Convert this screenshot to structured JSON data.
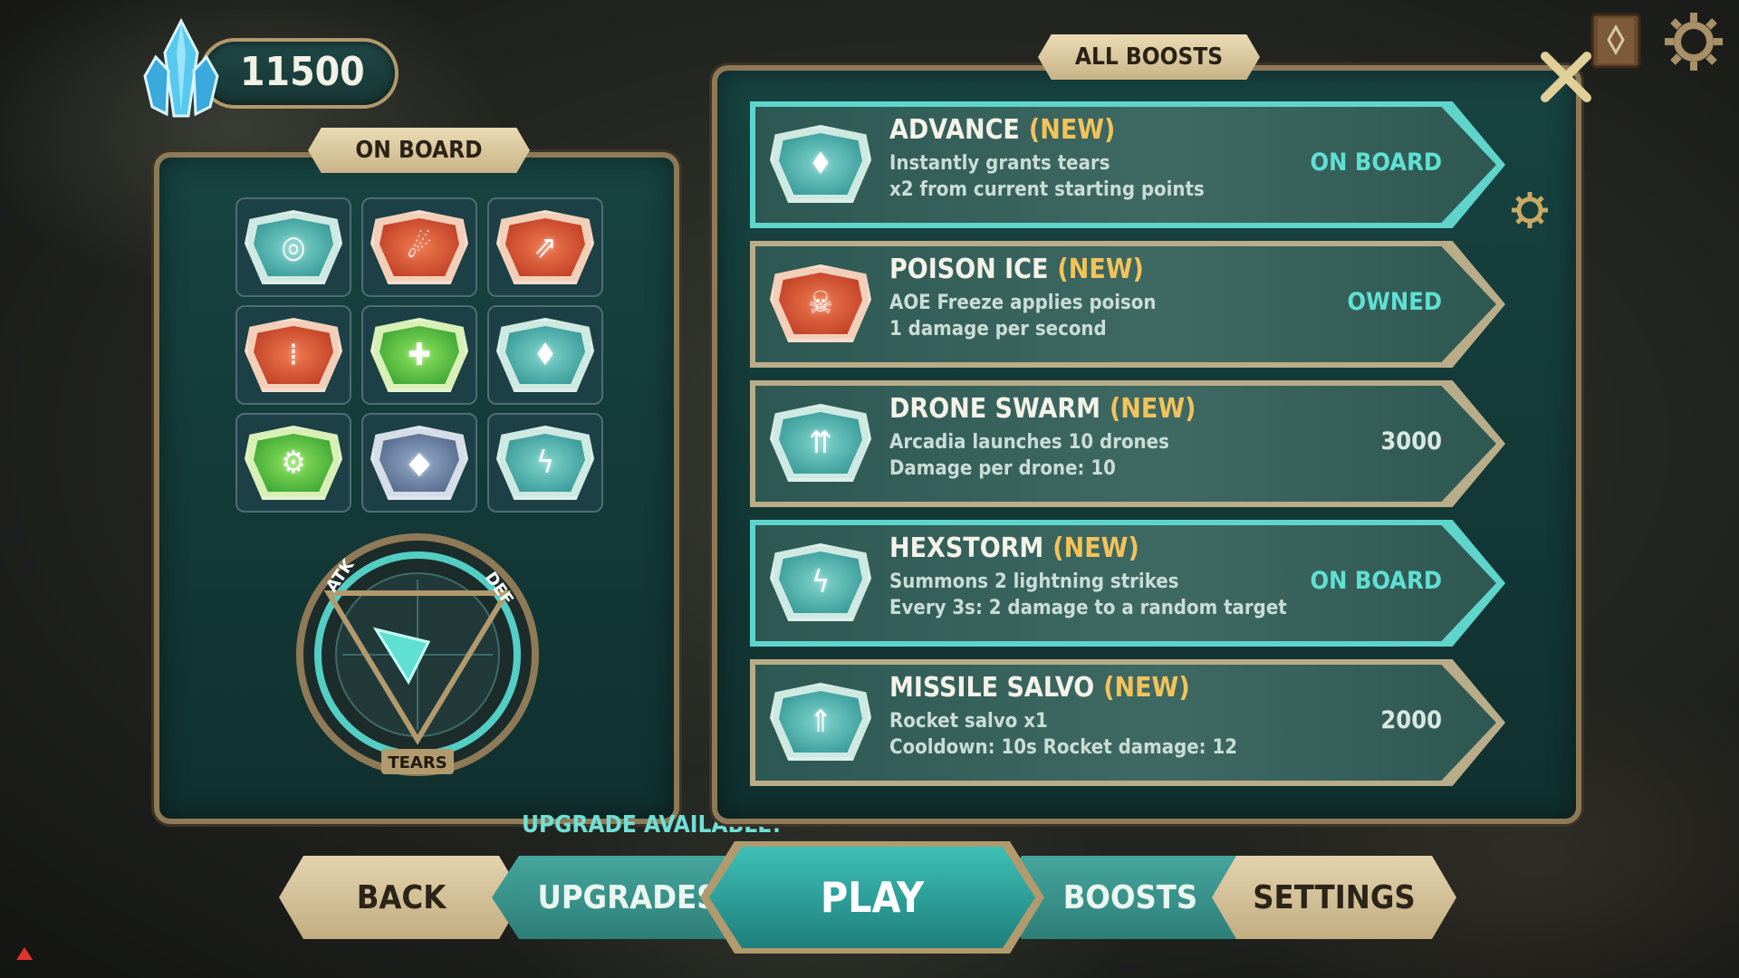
{
  "currency": {
    "amount": "11500",
    "icon": "crystal-icon"
  },
  "board": {
    "title": "ON BOARD",
    "slots": [
      {
        "icon": "burning-ring-icon",
        "color": "teal",
        "glyph": "◎"
      },
      {
        "icon": "meteor-icon",
        "color": "red",
        "glyph": "☄"
      },
      {
        "icon": "rocket-icon",
        "color": "red",
        "glyph": "⇗"
      },
      {
        "icon": "bullets-icon",
        "color": "red",
        "glyph": "⁞"
      },
      {
        "icon": "repair-cross-icon",
        "color": "green",
        "glyph": "✚"
      },
      {
        "icon": "crystal-shard-icon",
        "color": "teal",
        "glyph": "♦"
      },
      {
        "icon": "gear-wrench-icon",
        "color": "green",
        "glyph": "⚙"
      },
      {
        "icon": "crystal-cluster-icon",
        "color": "blue",
        "glyph": "◆"
      },
      {
        "icon": "lightning-icon",
        "color": "teal",
        "glyph": "ϟ"
      }
    ],
    "dial": {
      "atk": "ATK",
      "def": "DEF",
      "tears": "TEARS"
    },
    "upgrade_notice": "UPGRADE AVAILABLE!"
  },
  "boosts": {
    "title": "ALL BOOSTS",
    "items": [
      {
        "name": "ADVANCE",
        "tag": "(NEW)",
        "line1": "Instantly grants tears",
        "line2": "x2 from current starting points",
        "status": "ON BOARD",
        "state": "onboard",
        "icon": "crystal-icon",
        "badge_color": "teal"
      },
      {
        "name": "POISON ICE",
        "tag": "(NEW)",
        "line1": "AOE Freeze applies poison",
        "line2": "1 damage per second",
        "status": "OWNED",
        "state": "owned",
        "icon": "skull-drop-icon",
        "badge_color": "red"
      },
      {
        "name": "DRONE SWARM",
        "tag": "(NEW)",
        "line1": "Arcadia launches 10 drones",
        "line2": "Damage per drone: 10",
        "status": "3000",
        "state": "price",
        "icon": "drones-icon",
        "badge_color": "teal"
      },
      {
        "name": "HEXSTORM",
        "tag": "(NEW)",
        "line1": "Summons 2 lightning strikes",
        "line2": "Every 3s: 2 damage to a random target",
        "status": "ON BOARD",
        "state": "onboard",
        "icon": "lightning-icon",
        "badge_color": "teal"
      },
      {
        "name": "MISSILE SALVO",
        "tag": "(NEW)",
        "line1": "Rocket salvo x1",
        "line2": "Cooldown: 10s Rocket damage: 12",
        "status": "2000",
        "state": "price",
        "icon": "missiles-icon",
        "badge_color": "teal"
      }
    ]
  },
  "nav": {
    "back": "BACK",
    "upgrades": "UPGRADES",
    "play": "PLAY",
    "boosts": "BOOSTS",
    "settings": "SETTINGS"
  },
  "colors": {
    "accent_teal": "#5fe0d3",
    "new_tag": "#f2c35a",
    "frame_gold": "#8f7a57",
    "panel_bg": "#174341"
  }
}
